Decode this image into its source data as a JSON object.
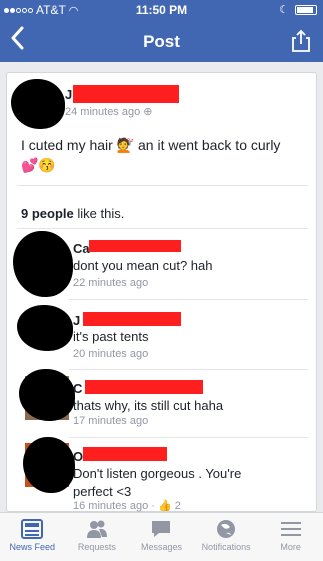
{
  "status": {
    "carrier": "AT&T",
    "time": "11:50 PM"
  },
  "nav": {
    "title": "Post",
    "back_icon": "back-chevron-icon",
    "share_icon": "share-icon"
  },
  "post": {
    "author_initial": "J",
    "time": "24 minutes ago",
    "text": "I cuted my hair 💇 an it went back to curly 💕😚",
    "likes_count": "9 people",
    "likes_suffix": " like this."
  },
  "comments": [
    {
      "initial": "Ca",
      "text": "dont you mean cut? hah",
      "time": "22 minutes ago"
    },
    {
      "initial": "J",
      "text": "it's past tents",
      "time": "20 minutes ago"
    },
    {
      "initial": "C",
      "text": "thats why, its still cut haha",
      "time": "17 minutes ago"
    },
    {
      "initial": "O",
      "text": "Don't listen gorgeous . You're perfect <3",
      "time": "16 minutes ago",
      "likes": "2"
    }
  ],
  "tabs": [
    {
      "label": "News Feed",
      "icon": "news-feed-icon"
    },
    {
      "label": "Requests",
      "icon": "requests-icon"
    },
    {
      "label": "Messages",
      "icon": "messages-icon"
    },
    {
      "label": "Notifications",
      "icon": "notifications-icon"
    },
    {
      "label": "More",
      "icon": "more-icon"
    }
  ],
  "colors": {
    "brand": "#4267b2",
    "redaction": "#ff1f1f"
  }
}
